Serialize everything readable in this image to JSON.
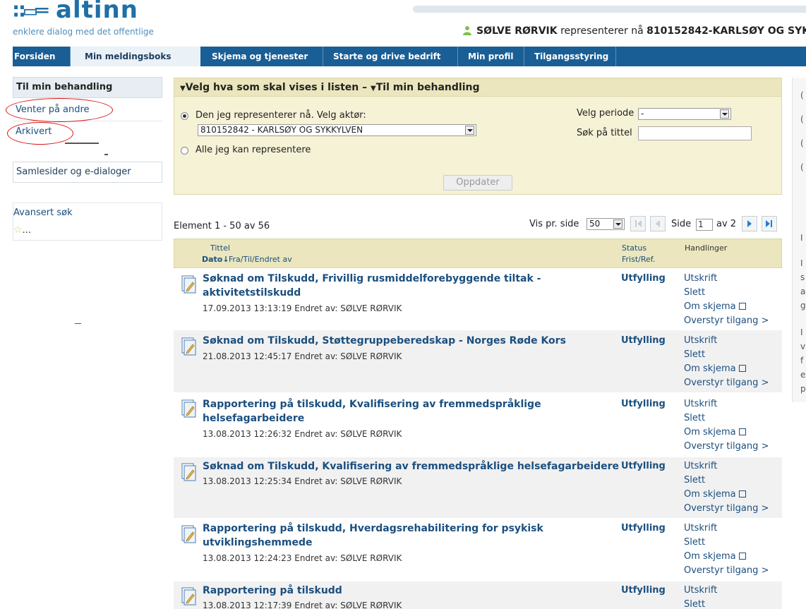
{
  "header": {
    "logo_text": "altinn",
    "tagline": "enklere dialog med det offentlige",
    "user_name": "SØLVE RØRVIK",
    "represents_text": "representerer nå",
    "org": "810152842-KARLSØY OG SYK"
  },
  "nav": {
    "tabs": [
      {
        "label": "Forsiden"
      },
      {
        "label": "Min meldingsboks"
      },
      {
        "label": "Skjema og tjenester"
      },
      {
        "label": "Starte og drive bedrift"
      },
      {
        "label": "Min profil"
      },
      {
        "label": "Tilgangsstyring"
      }
    ]
  },
  "sidebar": {
    "title": "Til min behandling",
    "items": [
      {
        "label": "Venter på andre"
      },
      {
        "label": "Arkivert"
      }
    ],
    "samlesider": "Samlesider og e-dialoger",
    "advanced_search": "Avansert søk",
    "favorites": "..."
  },
  "filter": {
    "heading_part1": "Velg hva som skal vises i listen –",
    "heading_part2": "Til min behandling",
    "radio_current": "Den jeg representerer nå. Velg aktør:",
    "actor_value": "810152842 - KARLSØY OG SYKKYLVEN",
    "radio_all": "Alle jeg kan representere",
    "period_label": "Velg periode",
    "period_value": "-",
    "search_title_label": "Søk på tittel",
    "update_button": "Oppdater"
  },
  "list": {
    "count_text": "Element 1 - 50 av 56",
    "per_page_label": "Vis pr. side",
    "per_page_value": "50",
    "page_label": "Side",
    "page_value": "1",
    "page_of": "av 2",
    "col_title": "Tittel",
    "col_date": "Dato↓",
    "col_from": "Fra/Til/Endret av",
    "col_status": "Status",
    "col_deadline": "Frist/Ref.",
    "col_actions": "Handlinger",
    "rows": [
      {
        "title": "Søknad om Tilskudd, Frivillig rusmiddelforebyggende tiltak - aktivitetstilskudd",
        "date": "17.09.2013 13:13:19 Endret av: SØLVE RØRVIK",
        "status": "Utfylling"
      },
      {
        "title": "Søknad om Tilskudd, Støttegruppeberedskap - Norges Røde Kors",
        "date": "21.08.2013 12:45:17 Endret av: SØLVE RØRVIK",
        "status": "Utfylling"
      },
      {
        "title": "Rapportering på tilskudd, Kvalifisering av fremmedspråklige helsefagarbeidere",
        "date": "13.08.2013 12:26:32 Endret av: SØLVE RØRVIK",
        "status": "Utfylling"
      },
      {
        "title": "Søknad om Tilskudd, Kvalifisering av fremmedspråklige helsefagarbeidere",
        "date": "13.08.2013 12:25:34 Endret av: SØLVE RØRVIK",
        "status": "Utfylling"
      },
      {
        "title": "Rapportering på tilskudd, Hverdagsrehabilitering for psykisk utviklingshemmede",
        "date": "13.08.2013 12:24:23 Endret av: SØLVE RØRVIK",
        "status": "Utfylling"
      },
      {
        "title": "Rapportering på tilskudd",
        "date": "13.08.2013 12:17:39 Endret av: SØLVE RØRVIK",
        "status": "Utfylling"
      }
    ],
    "actions": {
      "print": "Utskrift",
      "delete": "Slett",
      "about": "Om skjema",
      "override": "Overstyr tilgang >"
    }
  },
  "right_edge": {
    "chars": [
      "(",
      "(",
      "(",
      "(",
      "I",
      "I",
      "s",
      "a",
      "g",
      "I",
      "v",
      "f",
      "e",
      "p"
    ]
  },
  "colors": {
    "nav_blue": "#1a5e96",
    "link_blue": "#1b4f7f",
    "panel_yellow": "#f5f2d6",
    "annotation_red": "#dd1111"
  }
}
